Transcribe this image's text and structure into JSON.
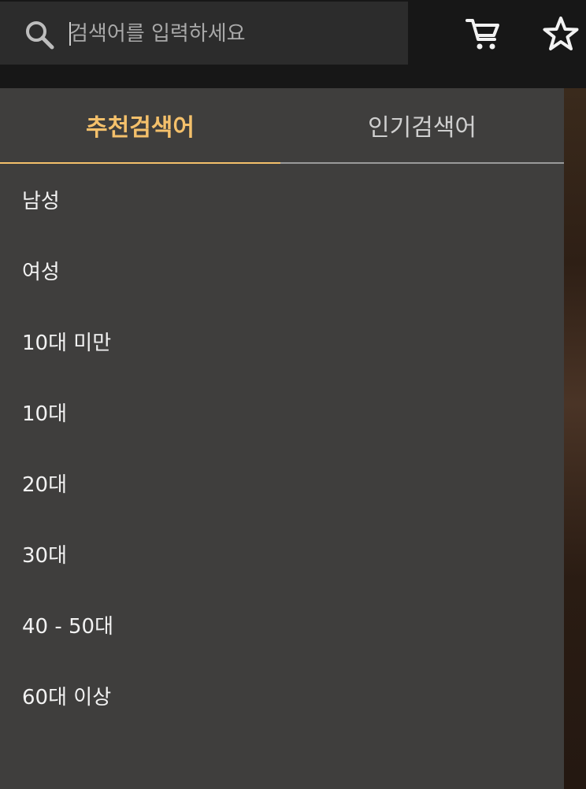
{
  "search": {
    "placeholder": "검색어를 입력하세요"
  },
  "header": {
    "icons": [
      "search-icon",
      "cart-icon",
      "star-icon"
    ]
  },
  "tabs": [
    {
      "label": "추천검색어",
      "active": true
    },
    {
      "label": "인기검색어",
      "active": false
    }
  ],
  "suggestions": [
    "남성",
    "여성",
    "10대 미만",
    "10대",
    "20대",
    "30대",
    "40 - 50대",
    "60대 이상"
  ],
  "colors": {
    "accent": "#f4c06b",
    "panel": "#3f3e3d",
    "topbar": "#171717",
    "search_box": "#2c2c2c"
  }
}
